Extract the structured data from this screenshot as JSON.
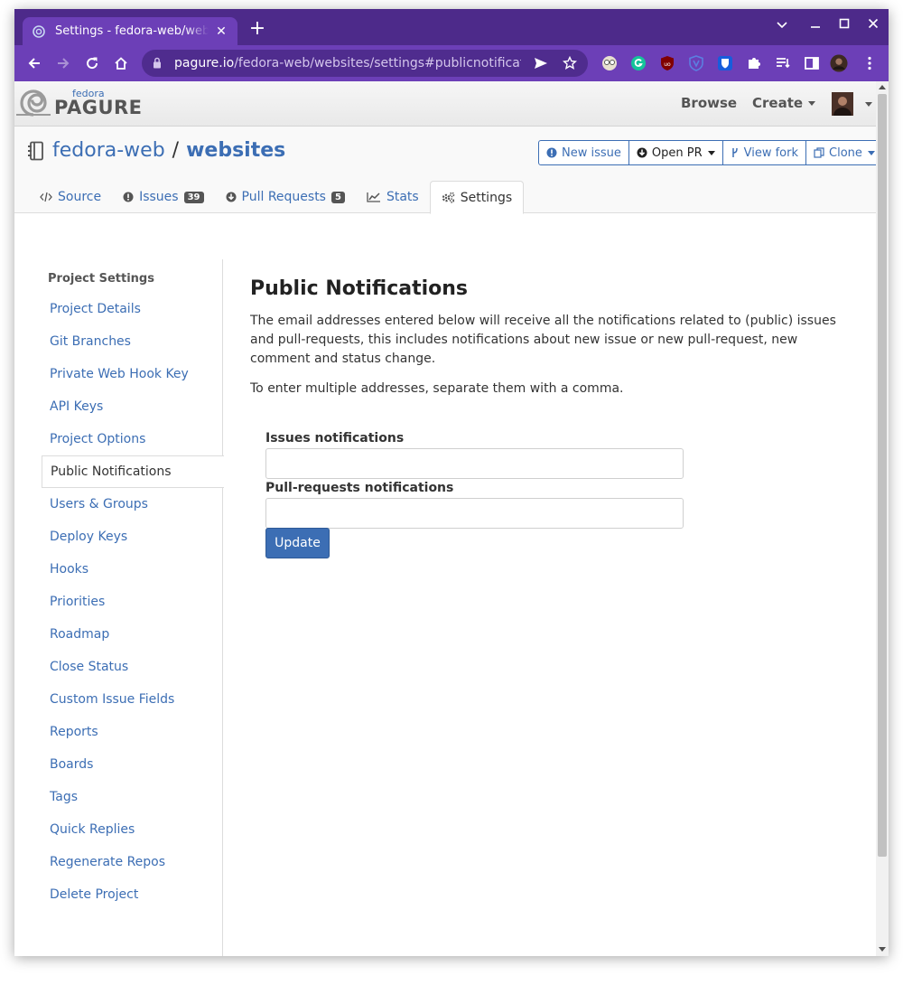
{
  "browser": {
    "tab_title": "Settings - fedora-web/websites - Pagure.io",
    "tab_close": "✕",
    "new_tab": "+",
    "url_host": "pagure.io",
    "url_path": "/fedora-web/websites/settings#publicnotifications-...",
    "window_controls": {
      "dropdown": "⌄",
      "minimize": "—",
      "maximize": "☐",
      "close": "✕"
    }
  },
  "header": {
    "logo_small": "fedora",
    "logo_big": "PAGURE",
    "browse": "Browse",
    "create": "Create"
  },
  "repo": {
    "namespace": "fedora-web",
    "separator": "/",
    "name": "websites",
    "buttons": {
      "new_issue": "New issue",
      "open_pr": "Open PR",
      "view_fork": "View fork",
      "clone": "Clone"
    },
    "tabs": {
      "source": "Source",
      "issues": "Issues",
      "issues_count": "39",
      "pull_requests": "Pull Requests",
      "pr_count": "5",
      "stats": "Stats",
      "settings": "Settings"
    }
  },
  "sidebar": {
    "title": "Project Settings",
    "items": [
      {
        "label": "Project Details"
      },
      {
        "label": "Git Branches"
      },
      {
        "label": "Private Web Hook Key"
      },
      {
        "label": "API Keys"
      },
      {
        "label": "Project Options"
      },
      {
        "label": "Public Notifications"
      },
      {
        "label": "Users & Groups"
      },
      {
        "label": "Deploy Keys"
      },
      {
        "label": "Hooks"
      },
      {
        "label": "Priorities"
      },
      {
        "label": "Roadmap"
      },
      {
        "label": "Close Status"
      },
      {
        "label": "Custom Issue Fields"
      },
      {
        "label": "Reports"
      },
      {
        "label": "Boards"
      },
      {
        "label": "Tags"
      },
      {
        "label": "Quick Replies"
      },
      {
        "label": "Regenerate Repos"
      },
      {
        "label": "Delete Project"
      }
    ]
  },
  "main": {
    "heading": "Public Notifications",
    "description": "The email addresses entered below will receive all the notifications related to (public) issues and pull-requests, this includes notifications about new issue or new pull-request, new comment and status change.",
    "hint": "To enter multiple addresses, separate them with a comma.",
    "issues_label": "Issues notifications",
    "issues_value": "",
    "pr_label": "Pull-requests notifications",
    "pr_value": "",
    "update_button": "Update"
  },
  "colors": {
    "browser_frame": "#4d2a8a",
    "browser_toolbar": "#6c3fb7",
    "link": "#3c6eb4",
    "primary_button": "#3c6eb4"
  },
  "icons": {
    "repo": "repo-icon",
    "source": "code-icon",
    "issues": "exclamation-circle-icon",
    "pull_requests": "arrow-circle-down-icon",
    "stats": "chart-line-icon",
    "settings": "gears-icon"
  }
}
